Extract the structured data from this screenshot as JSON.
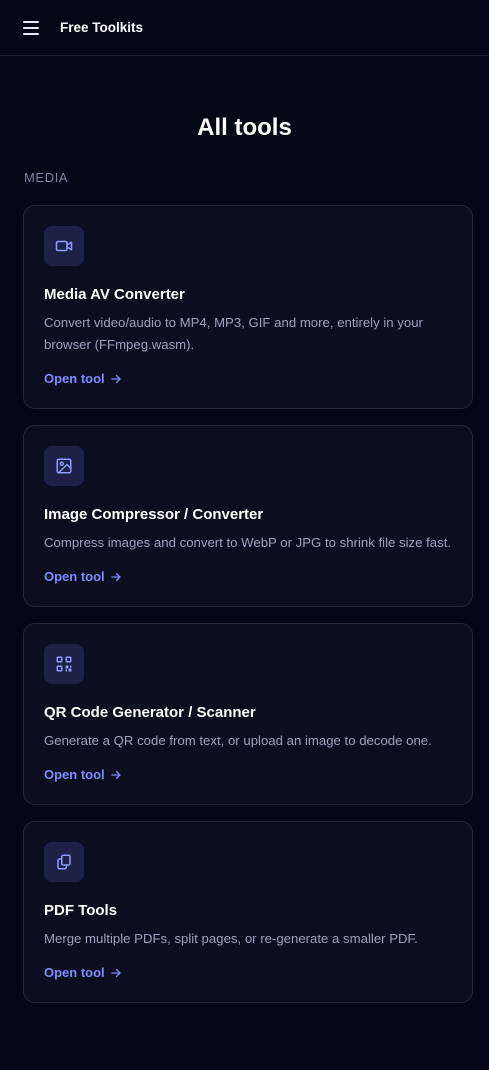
{
  "header": {
    "menu_icon": "hamburger-menu-icon",
    "brand": "Free Toolkits"
  },
  "page": {
    "title": "All tools"
  },
  "section": {
    "label": "MEDIA"
  },
  "colors": {
    "background": "#040816",
    "card_background": "#0a0e1e",
    "card_border": "#23293c",
    "icon_background": "#1c2247",
    "icon_color": "#8f9bff",
    "link_color": "#7c8cff",
    "muted_text": "#9aa2bd"
  },
  "tools": [
    {
      "icon": "video-camera-icon",
      "title": "Media AV Converter",
      "description": "Convert video/audio to MP4, MP3, GIF and more, entirely in your browser (FFmpeg.wasm).",
      "link_label": "Open tool",
      "link_icon": "arrow-right-icon"
    },
    {
      "icon": "image-icon",
      "title": "Image Compressor / Converter",
      "description": "Compress images and convert to WebP or JPG to shrink file size fast.",
      "link_label": "Open tool",
      "link_icon": "arrow-right-icon"
    },
    {
      "icon": "qr-code-icon",
      "title": "QR Code Generator / Scanner",
      "description": "Generate a QR code from text, or upload an image to decode one.",
      "link_label": "Open tool",
      "link_icon": "arrow-right-icon"
    },
    {
      "icon": "files-copy-icon",
      "title": "PDF Tools",
      "description": "Merge multiple PDFs, split pages, or re-generate a smaller PDF.",
      "link_label": "Open tool",
      "link_icon": "arrow-right-icon"
    }
  ]
}
